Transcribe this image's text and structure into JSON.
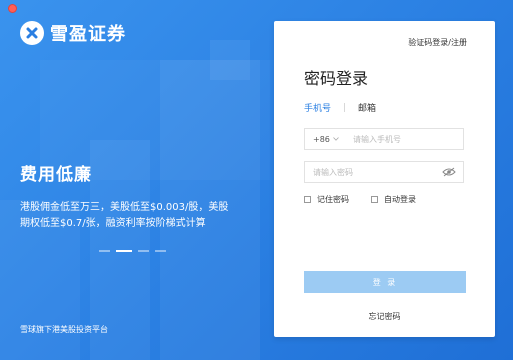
{
  "brand": {
    "name": "雪盈证券"
  },
  "promo": {
    "headline": "费用低廉",
    "line1": "港股佣金低至万三，美股低至$0.003/股，美股",
    "line2": "期权低至$0.7/张，融资利率按阶梯式计算",
    "slides_total": 4,
    "slide_active": 2
  },
  "footer": {
    "note": "雪球旗下港美股投资平台"
  },
  "panel": {
    "switch_link": "验证码登录/注册",
    "title": "密码登录",
    "tabs": [
      {
        "label": "手机号",
        "active": true
      },
      {
        "label": "邮箱",
        "active": false
      }
    ],
    "phone": {
      "country_code": "+86",
      "placeholder": "请输入手机号"
    },
    "password": {
      "placeholder": "请输入密码"
    },
    "remember_label": "记住密码",
    "auto_login_label": "自动登录",
    "login_button": "登 录",
    "forgot_link": "忘记密码"
  },
  "colors": {
    "background": "#2f86e6",
    "accent": "#2a7fe2",
    "button_disabled": "#9ccbf3"
  }
}
